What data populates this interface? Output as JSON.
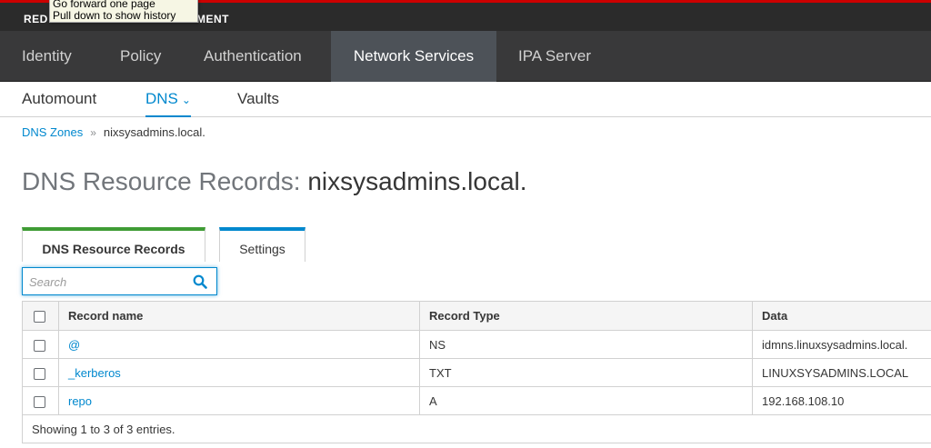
{
  "brand": {
    "left": "RED",
    "right": "MENT"
  },
  "tooltip": {
    "line1": "Go forward one page",
    "line2": "Pull down to show history"
  },
  "main_nav": {
    "tabs": [
      {
        "label": "Identity"
      },
      {
        "label": "Policy"
      },
      {
        "label": "Authentication"
      },
      {
        "label": "Network Services",
        "active": true
      },
      {
        "label": "IPA Server"
      }
    ]
  },
  "sub_nav": {
    "items": [
      {
        "label": "Automount"
      },
      {
        "label": "DNS",
        "active": true
      },
      {
        "label": "Vaults"
      }
    ]
  },
  "breadcrumb": {
    "parent": "DNS Zones",
    "separator": "»",
    "current": "nixsysadmins.local."
  },
  "page_title": {
    "prefix": "DNS Resource Records:",
    "zone": "nixsysadmins.local."
  },
  "facets": [
    {
      "label": "DNS Resource Records",
      "active": true,
      "accent": "#3f9c35"
    },
    {
      "label": "Settings",
      "accent": "#0088ce"
    }
  ],
  "search": {
    "placeholder": "Search",
    "value": ""
  },
  "table": {
    "columns": [
      "Record name",
      "Record Type",
      "Data"
    ],
    "rows": [
      {
        "name": "@",
        "type": "NS",
        "data": "idmns.linuxsysadmins.local."
      },
      {
        "name": "_kerberos",
        "type": "TXT",
        "data": "LINUXSYSADMINS.LOCAL"
      },
      {
        "name": "repo",
        "type": "A",
        "data": "192.168.108.10"
      }
    ],
    "footer": "Showing 1 to 3 of 3 entries."
  },
  "colors": {
    "accent": "#0088ce",
    "active_facet": "#3f9c35",
    "brand_red": "#cc0000",
    "nav_bg": "#39393a"
  }
}
